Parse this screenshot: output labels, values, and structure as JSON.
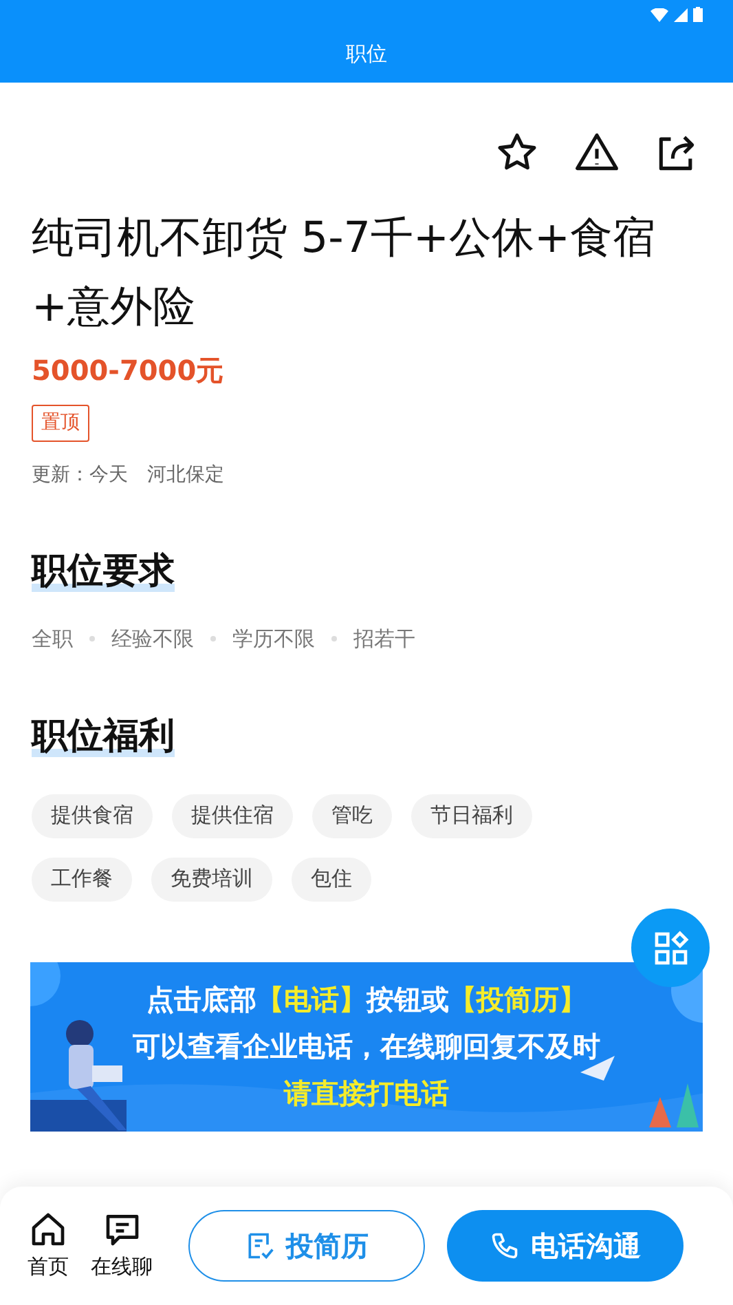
{
  "app_bar": {
    "title": "职位"
  },
  "job": {
    "title": "纯司机不卸货 5-7千+公休+食宿+意外险",
    "salary": "5000-7000元",
    "badge": "置顶",
    "updated": "更新：今天",
    "location": "河北保定"
  },
  "requirements": {
    "heading": "职位要求",
    "items": [
      "全职",
      "经验不限",
      "学历不限",
      "招若干"
    ]
  },
  "benefits": {
    "heading": "职位福利",
    "items": [
      "提供食宿",
      "提供住宿",
      "管吃",
      "节日福利",
      "工作餐",
      "免费培训",
      "包住"
    ]
  },
  "banner": {
    "lines": [
      [
        {
          "text": "点击底部",
          "highlight": false
        },
        {
          "text": "【电话】",
          "highlight": true
        },
        {
          "text": "按钮或",
          "highlight": false
        },
        {
          "text": "【投简历】",
          "highlight": true
        }
      ],
      [
        {
          "text": "可以查看企业电话，在线聊回复不及时",
          "highlight": false
        }
      ],
      [
        {
          "text": "请直接打电话",
          "highlight": true
        }
      ]
    ]
  },
  "bottom_bar": {
    "nav": [
      {
        "kind": "home",
        "label": "首页"
      },
      {
        "kind": "chat",
        "label": "在线聊"
      }
    ],
    "resume_button": "投简历",
    "call_button": "电话沟通"
  }
}
